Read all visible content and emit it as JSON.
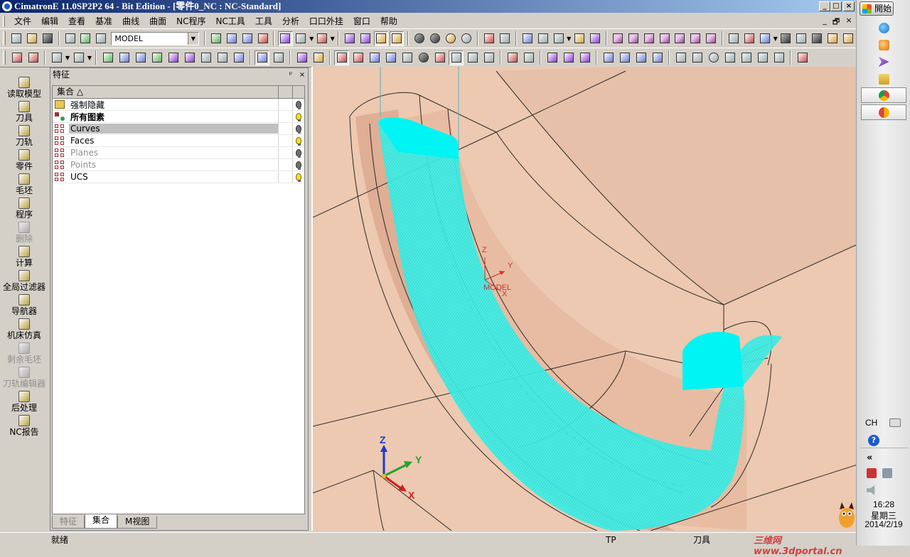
{
  "window": {
    "title": "CimatronE 11.0SP2P2 64 - Bit Edition - [零件0_NC : NC-Standard]",
    "controls": {
      "minimize": "_",
      "maximize": "□",
      "close": "×"
    },
    "doc_controls": {
      "minimize": "_",
      "restore": "🗗",
      "close": "×"
    }
  },
  "menu": {
    "items": [
      "文件",
      "编辑",
      "查看",
      "基准",
      "曲线",
      "曲面",
      "NC程序",
      "NC工具",
      "工具",
      "分析",
      "口口外挂",
      "窗口",
      "帮助"
    ]
  },
  "toolbar": {
    "model_select": {
      "value": "MODEL"
    }
  },
  "leftbar": {
    "items": [
      {
        "label": "读取模型",
        "enabled": true
      },
      {
        "label": "刀具",
        "enabled": true
      },
      {
        "label": "刀轨",
        "enabled": true
      },
      {
        "label": "零件",
        "enabled": true
      },
      {
        "label": "毛坯",
        "enabled": true
      },
      {
        "label": "程序",
        "enabled": true
      },
      {
        "label": "删除",
        "enabled": false
      },
      {
        "label": "计算",
        "enabled": true
      },
      {
        "label": "全局过滤器",
        "enabled": true
      },
      {
        "label": "导航器",
        "enabled": true
      },
      {
        "label": "机床仿真",
        "enabled": true
      },
      {
        "label": "剩余毛坯",
        "enabled": false
      },
      {
        "label": "刀轨编辑器",
        "enabled": false
      },
      {
        "label": "后处理",
        "enabled": true
      },
      {
        "label": "NC报告",
        "enabled": true
      }
    ]
  },
  "panel": {
    "title": "特征",
    "pin_label": "ᵖ",
    "close_label": "×",
    "column_header": "集合 △",
    "rows": [
      {
        "label": "强制隐藏",
        "icon": "folder",
        "bulb": "off",
        "style": "normal"
      },
      {
        "label": "所有图素",
        "icon": "allent",
        "bulb": "on",
        "style": "bold"
      },
      {
        "label": "Curves",
        "icon": "grid",
        "bulb": "off",
        "style": "selected"
      },
      {
        "label": "Faces",
        "icon": "grid",
        "bulb": "on",
        "style": "normal"
      },
      {
        "label": "Planes",
        "icon": "grid",
        "bulb": "off",
        "style": "dim"
      },
      {
        "label": "Points",
        "icon": "grid",
        "bulb": "off",
        "style": "dim"
      },
      {
        "label": "UCS",
        "icon": "grid",
        "bulb": "on",
        "style": "normal"
      }
    ],
    "tabs": [
      {
        "label": "特征",
        "active": false
      },
      {
        "label": "集合",
        "active": true
      },
      {
        "label": "M视图",
        "active": false
      }
    ]
  },
  "viewport": {
    "model_ucs": {
      "x": "X",
      "y": "Y",
      "z": "Z",
      "name": "MODEL"
    },
    "axis_triad": {
      "x": "X",
      "y": "Y",
      "z": "Z"
    },
    "colors": {
      "part": "#ecc9b0",
      "toolpath": "#00f0f0",
      "background": "#dcdcdc"
    }
  },
  "statusbar": {
    "ready": "就绪",
    "mode": "TP",
    "tool": "刀具",
    "watermark": "三维网www.3dportal.cn"
  },
  "taskbar": {
    "start_label": "開始",
    "lang": "CH",
    "help": "?",
    "chevron": "«",
    "time": "16:28",
    "weekday": "星期三",
    "date": "2014/2/19"
  }
}
